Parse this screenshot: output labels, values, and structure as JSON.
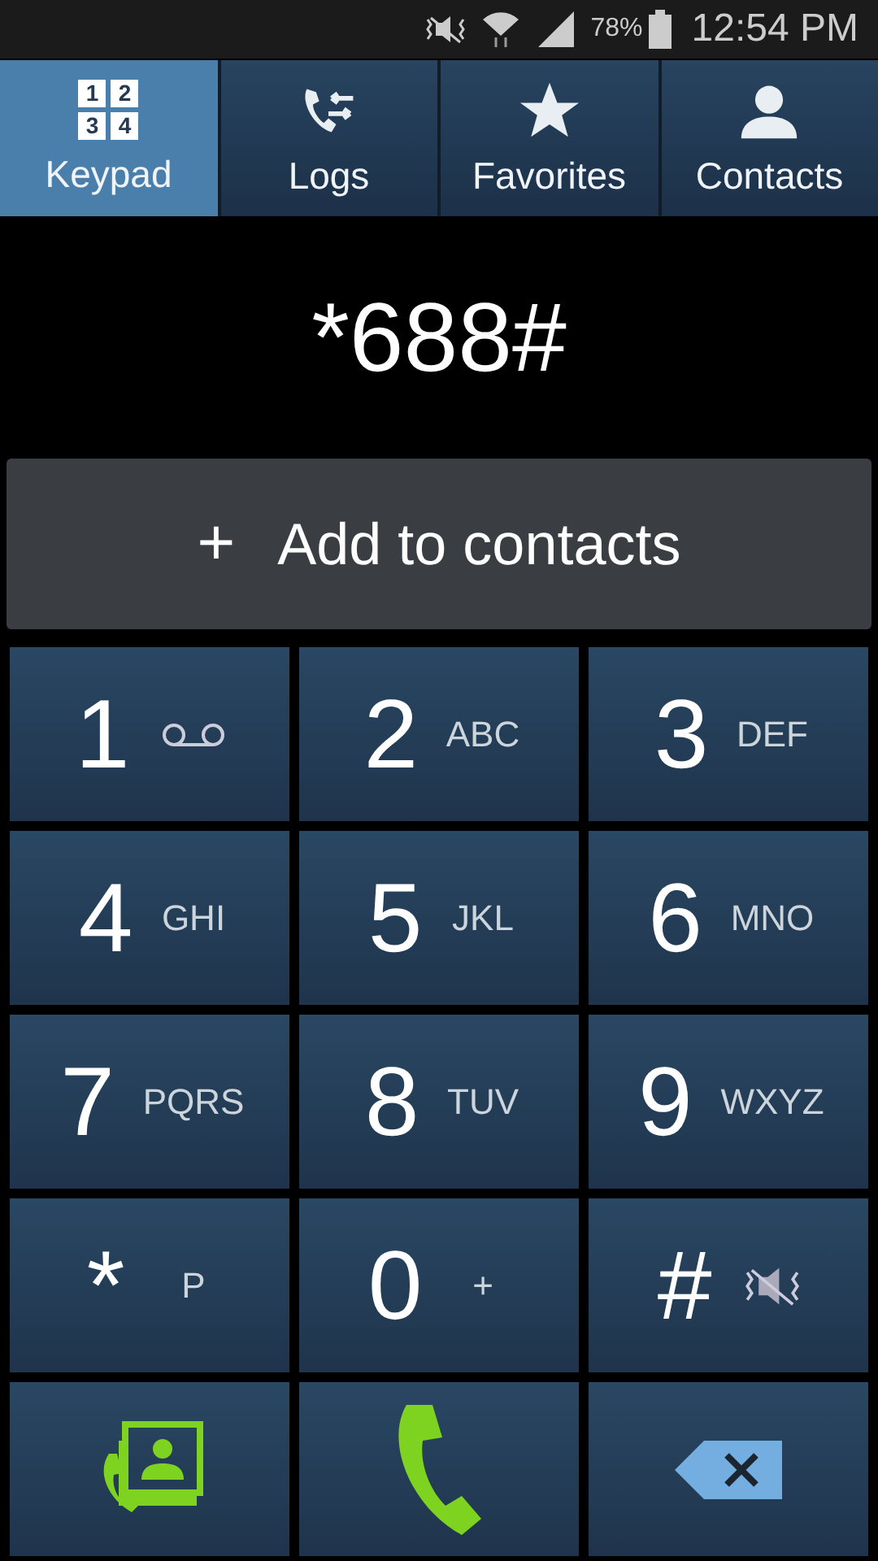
{
  "status_bar": {
    "battery": "78%",
    "time": "12:54 PM"
  },
  "tabs": [
    {
      "label": "Keypad",
      "kind": "keypad",
      "icon_digits": [
        "1",
        "2",
        "3",
        "4"
      ],
      "selected": true
    },
    {
      "label": "Logs",
      "kind": "logs",
      "selected": false
    },
    {
      "label": "Favorites",
      "kind": "star",
      "selected": false
    },
    {
      "label": "Contacts",
      "kind": "person",
      "selected": false
    }
  ],
  "dialed_number": "*688#",
  "add_contact": {
    "icon": "+",
    "label": "Add to contacts"
  },
  "keys": [
    {
      "digit": "1",
      "kind": "voicemail"
    },
    {
      "digit": "2",
      "kind": "text",
      "letters": "ABC"
    },
    {
      "digit": "3",
      "kind": "text",
      "letters": "DEF"
    },
    {
      "digit": "4",
      "kind": "text",
      "letters": "GHI"
    },
    {
      "digit": "5",
      "kind": "text",
      "letters": "JKL"
    },
    {
      "digit": "6",
      "kind": "text",
      "letters": "MNO"
    },
    {
      "digit": "7",
      "kind": "text",
      "letters": "PQRS"
    },
    {
      "digit": "8",
      "kind": "text",
      "letters": "TUV"
    },
    {
      "digit": "9",
      "kind": "text",
      "letters": "WXYZ"
    },
    {
      "digit": "*",
      "kind": "text",
      "letters": "P"
    },
    {
      "digit": "0",
      "kind": "text",
      "letters": "+"
    },
    {
      "digit": "#",
      "kind": "mute"
    }
  ]
}
